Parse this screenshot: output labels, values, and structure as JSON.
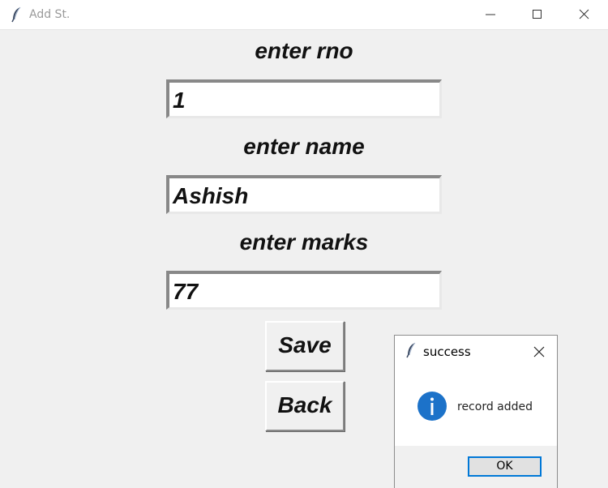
{
  "window": {
    "title": "Add St.",
    "icon": "feather-icon"
  },
  "form": {
    "rno_label": "enter rno",
    "rno_value": "1",
    "name_label": "enter name",
    "name_value": "Ashish",
    "marks_label": "enter marks",
    "marks_value": "77"
  },
  "buttons": {
    "save": "Save",
    "back": "Back"
  },
  "dialog": {
    "title": "success",
    "message": "record added",
    "ok": "OK",
    "icon": "info-icon",
    "accent": "#0078d7"
  }
}
